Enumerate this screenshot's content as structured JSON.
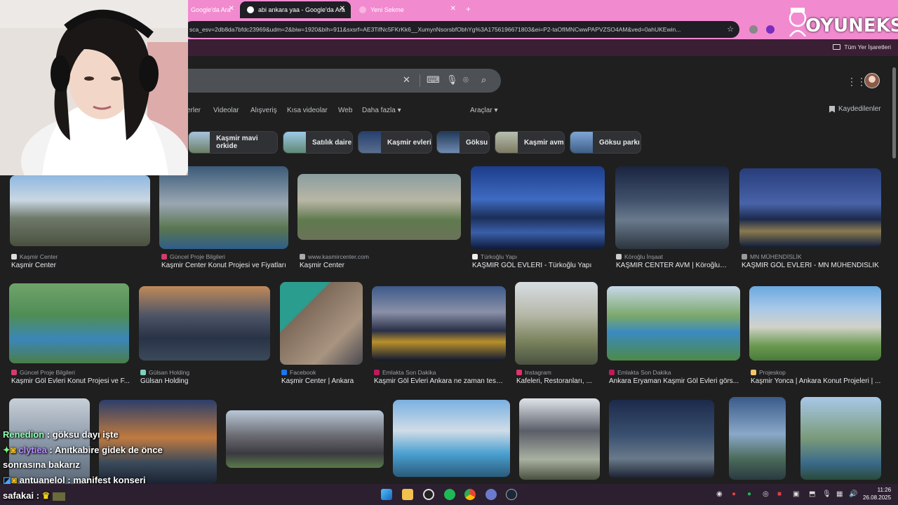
{
  "browser": {
    "tabs": [
      {
        "label": "Google'da Ara"
      },
      {
        "label": "abi ankara yaa - Google'da Ara"
      },
      {
        "label": "Yeni Sekme"
      }
    ],
    "address": "sca_esv=2db8da7bfdc23969&udm=2&biw=1920&bih=911&sxsrf=AE3TifNc5FKrKk6__XumynNsorsbfObhYg%3A1756196671803&ei=P2-taOfIMNCwwPAPVZSO4AM&ved=0ahUKEwin...",
    "bookmark_all": "Tüm Yer İşaretleri"
  },
  "google": {
    "nav_tabs": [
      "erler",
      "Videolar",
      "Alışveriş",
      "Kısa videolar",
      "Web",
      "Daha fazla ▾",
      "Araçlar ▾"
    ],
    "saved": "Kaydedilenler",
    "chips": [
      "Kaşmir mavi orkide",
      "Satılık daire",
      "Kaşmir evleri",
      "Göksu",
      "Kaşmir avm",
      "Göksu parkı"
    ],
    "results_row1": [
      {
        "source": "Kaşmir Center",
        "title": "Kaşmir Center"
      },
      {
        "source": "Güncel Proje Bilgileri",
        "title": "Kaşmir Center Konut Projesi ve Fiyatları"
      },
      {
        "source": "www.kasmircenter.com",
        "title": "Kaşmir Center"
      },
      {
        "source": "Türkoğlu Yapı",
        "title": "KAŞMİR GÖL EVLERİ - Türkoğlu Yapı"
      },
      {
        "source": "Köroğlu İnşaat",
        "title": "KAŞMİR CENTER AVM | Köroğlu İ..."
      },
      {
        "source": "MN MÜHENDİSLİK",
        "title": "KAŞMİR GÖL EVLERİ - MN MÜHENDİSLİK"
      }
    ],
    "results_row2": [
      {
        "source": "Güncel Proje Bilgileri",
        "title": "Kaşmir Göl Evleri Konut Projesi ve F..."
      },
      {
        "source": "Gülsan Holding",
        "title": "Gülsan Holding"
      },
      {
        "source": "Facebook",
        "title": "Kaşmir Center | Ankara"
      },
      {
        "source": "Emlakta Son Dakika",
        "title": "Kaşmir Göl Evleri Ankara ne zaman tesli..."
      },
      {
        "source": "Instagram",
        "title": "Kafeleri, Restoranları, ..."
      },
      {
        "source": "Emlakta Son Dakika",
        "title": "Ankara Eryaman Kaşmir Göl Evleri görs..."
      },
      {
        "source": "Projeskop",
        "title": "Kaşmir Yonca | Ankara Konut Projeleri | ..."
      }
    ]
  },
  "chat": [
    {
      "user": "Renedion",
      "text": " : göksu dayı işte"
    },
    {
      "user": "clytiea",
      "text": " : Anıtkabire gidek de önce"
    },
    {
      "user": "",
      "text": "sonrasına bakarız"
    },
    {
      "user": "antuanelol",
      "text": " : manifest konseri"
    },
    {
      "user": "safakai",
      "text": " :"
    }
  ],
  "watermark": "OYUNEKS",
  "taskbar": {
    "time": "11:26",
    "date": "26.08.2025"
  },
  "colors": {
    "tabbar": "#f28ad0",
    "page_bg": "#1f1f1f",
    "chat_name": "#8fffb2"
  }
}
